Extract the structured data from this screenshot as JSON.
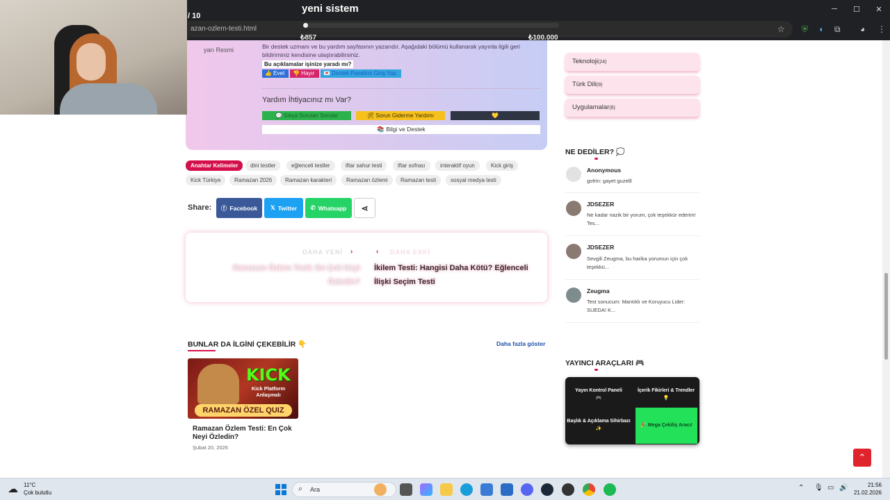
{
  "stream": {
    "title": "yeni sistem",
    "counter": "/ 10",
    "goal_start": "₺857",
    "goal_end": "₺100.000",
    "goal_fraction": 0.0086
  },
  "browser": {
    "url": "azan-ozlem-testi.html"
  },
  "article": {
    "image_alt": "yarı Resmi",
    "author_desc": "Bir destek uzmanı ve bu yardım sayfasının yazarıdır. Aşağıdaki bölümü kullanarak yayınla ilgili geri bildiriminiz kendisine ulaştırabilirsiniz.",
    "helpful_question": "Bu açıklamalar işinize yaradı mı?",
    "feedback_yes": "👍 Evet",
    "feedback_no": "👎 Hayır",
    "feedback_panel": "💌 Destek Paneline Giriş Yap",
    "help_title": "Yardım İhtiyacınız mı Var?",
    "help_faq": "💬 Sıkça Sorulan Sorular",
    "help_trouble": "🛠 Sorun Giderme Yardımı",
    "help_heart": "💛",
    "help_info": "📚 Bilgi ve Destek"
  },
  "tags": {
    "title": "Anahtar Kelimeler",
    "items": [
      "dini testler",
      "eğlenceli testler",
      "iftar sahur testi",
      "iftar sofrası",
      "interaktif oyun",
      "Kick giriş",
      "Kick Türkiye",
      "Ramazan 2026",
      "Ramazan karakteri",
      "Ramazan özlemi",
      "Ramazan testi",
      "sosyal medya testi"
    ]
  },
  "share": {
    "label": "Share:",
    "facebook": "Facebook",
    "twitter": "Twitter",
    "whatsapp": "Whatsapp"
  },
  "post_nav": {
    "newer_label": "DAHA YENİ",
    "newer_title": "Ramazan Özlem Testi: En Çok Neyi Özledin?",
    "older_label": "DAHA ESKİ",
    "older_title": "İkilem Testi: Hangisi Daha Kötü? Eğlenceli İlişki Seçim Testi"
  },
  "related": {
    "title": "BUNLAR DA İLGİNİ ÇEKEBİLİR 👇",
    "more": "Daha fazla göster",
    "card_brand": "KICK",
    "card_subtitle": "Kick Platform Anlaşmalı",
    "card_banner": "RAMAZAN ÖZEL QUIZ",
    "card_title": "Ramazan Özlem Testi: En Çok Neyi Özledin?",
    "card_date": "Şubat 20, 2026"
  },
  "sidebar": {
    "categories": [
      {
        "name": "Teknoloji",
        "count": "(24)"
      },
      {
        "name": "Türk Dili",
        "count": "(9)"
      },
      {
        "name": "Uygulamalar",
        "count": "(6)"
      }
    ],
    "said_title": "NE DEDİLER? 💭",
    "comments": [
      {
        "name": "Anonymous",
        "text": "gofrin: gayet guzelll"
      },
      {
        "name": "JDSEZER",
        "text": "Ne kadar nazik bir yorum, çok teşekkür ederim! Tes..."
      },
      {
        "name": "JDSEZER",
        "text": "Sevgili Zeugma, bu harika yorumun için çok teşekkü..."
      },
      {
        "name": "Zeugma",
        "text": "Test sonucum: Mantıklı ve Koruyucu Lider: SUEDA! K..."
      }
    ],
    "tools_title": "YAYINCI ARAÇLARI 🎮",
    "tools": {
      "panel": "Yayın Kontrol Paneli",
      "panel_icon": "🎮",
      "trends": "İçerik Fikirleri & Trendler",
      "trends_icon": "💡",
      "wizard": "Başlık & Açıklama Sihirbazı",
      "wizard_icon": "✨",
      "raffle": "🎉 Mega Çekiliş Aracı!"
    }
  },
  "taskbar": {
    "temp": "11°C",
    "condition": "Çok bulutlu",
    "search": "Ara",
    "time": "21:56",
    "date": "21.02.2026"
  },
  "colors": {
    "accent": "#d4104a",
    "chrome": "#202124",
    "taskbar": "#dfe6ee"
  }
}
